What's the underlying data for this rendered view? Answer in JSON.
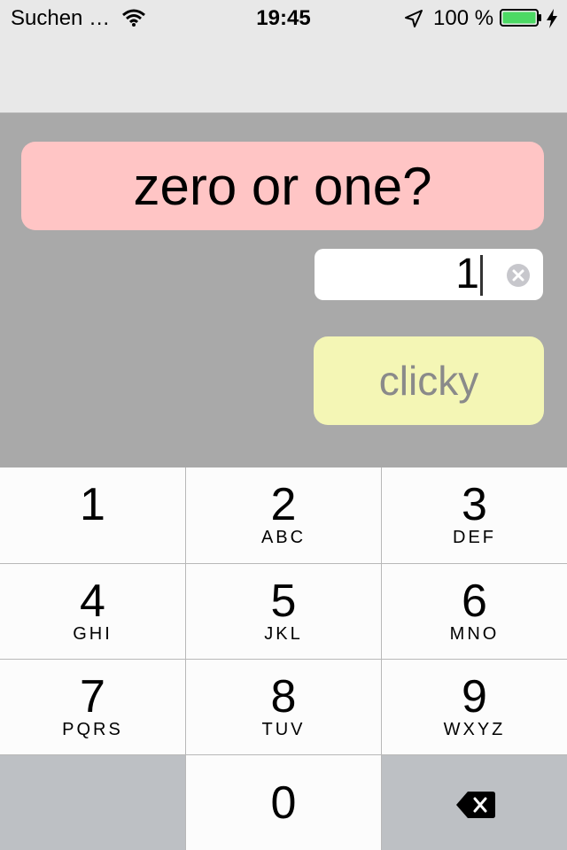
{
  "status_bar": {
    "carrier": "Suchen …",
    "time": "19:45",
    "battery_percent": "100 %",
    "battery_level": 1.0,
    "battery_color": "#4cd964",
    "icons": [
      "wifi-icon",
      "location-arrow-icon",
      "battery-icon",
      "charging-bolt-icon"
    ]
  },
  "main": {
    "question": "zero or one?",
    "question_bg": "#ffc5c5",
    "input_value": "1",
    "button_label": "clicky",
    "button_bg": "#f4f6b5",
    "background": "#a9a9a9"
  },
  "keypad": {
    "keys": [
      {
        "digit": "1",
        "letters": ""
      },
      {
        "digit": "2",
        "letters": "ABC"
      },
      {
        "digit": "3",
        "letters": "DEF"
      },
      {
        "digit": "4",
        "letters": "GHI"
      },
      {
        "digit": "5",
        "letters": "JKL"
      },
      {
        "digit": "6",
        "letters": "MNO"
      },
      {
        "digit": "7",
        "letters": "PQRS"
      },
      {
        "digit": "8",
        "letters": "TUV"
      },
      {
        "digit": "9",
        "letters": "WXYZ"
      },
      {
        "digit": "0",
        "letters": ""
      }
    ],
    "delete_icon": "backspace-icon"
  }
}
